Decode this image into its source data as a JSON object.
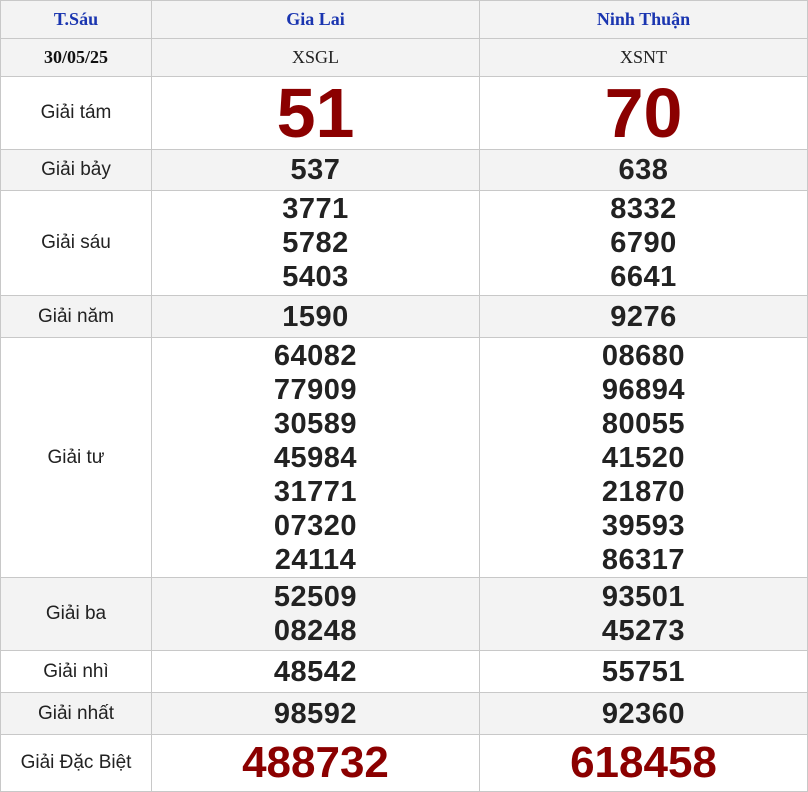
{
  "header": {
    "day": "T.Sáu",
    "date": "30/05/25",
    "provinces": [
      {
        "name": "Gia Lai",
        "code": "XSGL"
      },
      {
        "name": "Ninh Thuận",
        "code": "XSNT"
      }
    ]
  },
  "prizes": {
    "g8": {
      "label": "Giải tám",
      "values": [
        "51",
        "70"
      ]
    },
    "g7": {
      "label": "Giải bảy",
      "values": [
        "537",
        "638"
      ]
    },
    "g6": {
      "label": "Giải sáu",
      "p1": [
        "3771",
        "5782",
        "5403"
      ],
      "p2": [
        "8332",
        "6790",
        "6641"
      ]
    },
    "g5": {
      "label": "Giải năm",
      "values": [
        "1590",
        "9276"
      ]
    },
    "g4": {
      "label": "Giải tư",
      "p1": [
        "64082",
        "77909",
        "30589",
        "45984",
        "31771",
        "07320",
        "24114"
      ],
      "p2": [
        "08680",
        "96894",
        "80055",
        "41520",
        "21870",
        "39593",
        "86317"
      ]
    },
    "g3": {
      "label": "Giải ba",
      "p1": [
        "52509",
        "08248"
      ],
      "p2": [
        "93501",
        "45273"
      ]
    },
    "g2": {
      "label": "Giải nhì",
      "values": [
        "48542",
        "55751"
      ]
    },
    "g1": {
      "label": "Giải nhất",
      "values": [
        "98592",
        "92360"
      ]
    },
    "gdb": {
      "label": "Giải Đặc Biệt",
      "values": [
        "488732",
        "618458"
      ]
    }
  },
  "colors": {
    "header_text": "#1a35b0",
    "highlight_number": "#8b0000",
    "row_alt_bg": "#f3f3f3",
    "border": "#c8c8c8"
  }
}
